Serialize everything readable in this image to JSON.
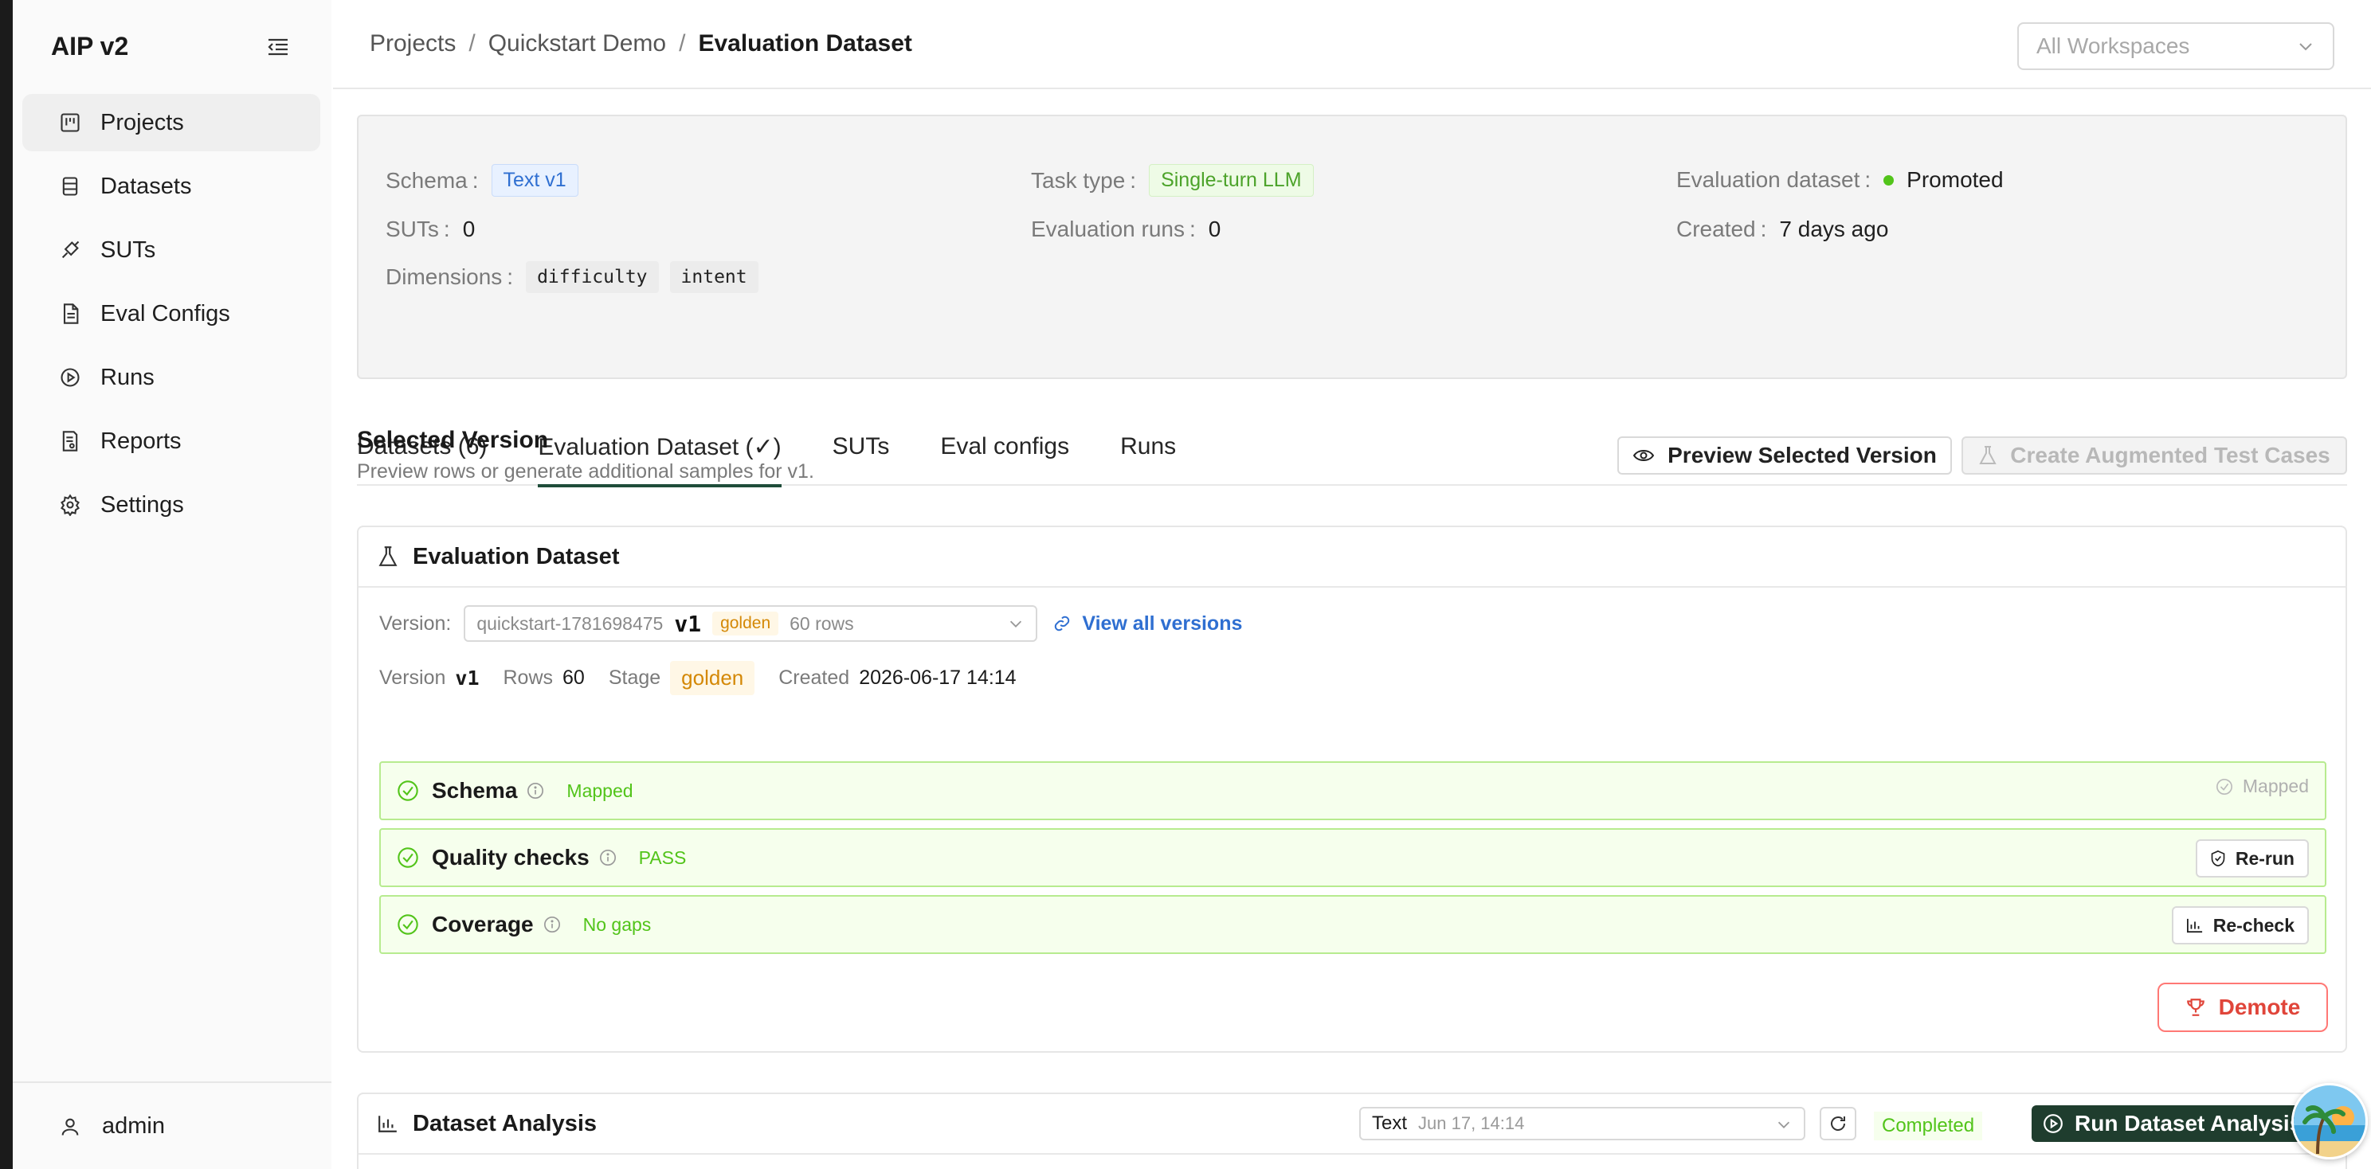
{
  "app": {
    "title": "AIP v2"
  },
  "sidebar": {
    "items": [
      {
        "label": "Projects",
        "icon": "projects-icon",
        "active": true
      },
      {
        "label": "Datasets",
        "icon": "datasets-icon"
      },
      {
        "label": "SUTs",
        "icon": "suts-icon"
      },
      {
        "label": "Eval Configs",
        "icon": "eval-configs-icon"
      },
      {
        "label": "Runs",
        "icon": "runs-icon"
      },
      {
        "label": "Reports",
        "icon": "reports-icon"
      },
      {
        "label": "Settings",
        "icon": "settings-icon"
      }
    ],
    "user": "admin"
  },
  "header": {
    "breadcrumb": [
      "Projects",
      "Quickstart Demo",
      "Evaluation Dataset"
    ],
    "workspace_placeholder": "All Workspaces"
  },
  "summary": {
    "schema_label": "Schema",
    "schema_value": "Text v1",
    "task_label": "Task type",
    "task_value": "Single-turn LLM",
    "evalds_label": "Evaluation dataset",
    "evalds_value": "Promoted",
    "suts_label": "SUTs",
    "suts_value": "0",
    "runs_label": "Evaluation runs",
    "runs_value": "0",
    "created_label": "Created",
    "created_value": "7 days ago",
    "dims_label": "Dimensions",
    "dims": [
      "difficulty",
      "intent"
    ]
  },
  "tabs": [
    "Datasets (6)",
    "Evaluation Dataset (✓)",
    "SUTs",
    "Eval configs",
    "Runs"
  ],
  "selected_version": {
    "title": "Selected Version",
    "subtitle": "Preview rows or generate additional samples for v1.",
    "preview_btn": "Preview Selected Version",
    "augment_btn": "Create Augmented Test Cases"
  },
  "eval_card": {
    "title": "Evaluation Dataset",
    "version_label": "Version:",
    "version_id": "quickstart-1781698475",
    "version_num": "v1",
    "version_stage": "golden",
    "version_rows": "60 rows",
    "view_all": "View all versions",
    "meta": {
      "version_label": "Version",
      "version_value": "v1",
      "rows_label": "Rows",
      "rows_value": "60",
      "stage_label": "Stage",
      "stage_value": "golden",
      "created_label": "Created",
      "created_value": "2026-06-17 14:14"
    },
    "checks": [
      {
        "name": "Schema",
        "status": "Mapped",
        "right": "Mapped"
      },
      {
        "name": "Quality checks",
        "status": "PASS",
        "action": "Re-run"
      },
      {
        "name": "Coverage",
        "status": "No gaps",
        "action": "Re-check"
      }
    ],
    "demote": "Demote"
  },
  "analysis": {
    "title": "Dataset Analysis",
    "select_main": "Text",
    "select_sub": "Jun 17, 14:14",
    "status": "Completed",
    "run_btn": "Run Dataset Analysis"
  },
  "colors": {
    "accent": "#1f4d3a",
    "success": "#52c41a",
    "danger": "#e0453a",
    "link": "#2f6fd1",
    "gold": "#d48806"
  }
}
